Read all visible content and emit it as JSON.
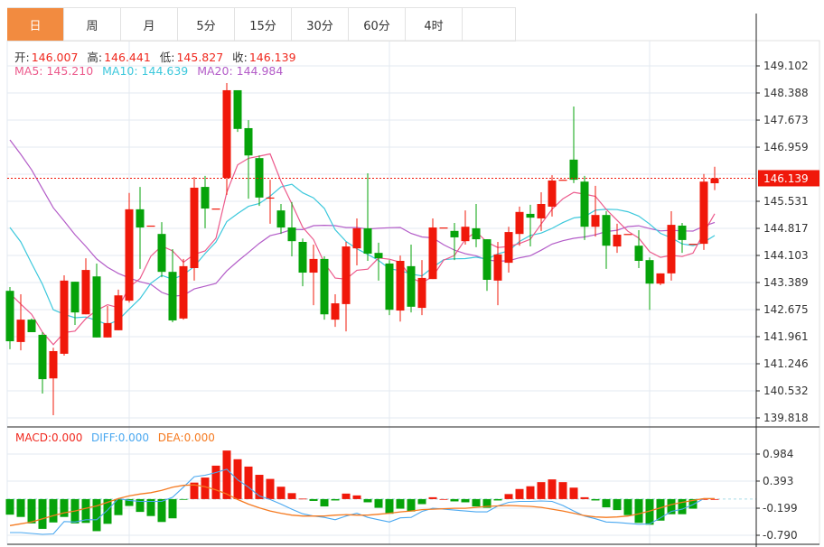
{
  "tabs": [
    {
      "label": "日",
      "active": true
    },
    {
      "label": "周"
    },
    {
      "label": "月"
    },
    {
      "label": "5分"
    },
    {
      "label": "15分"
    },
    {
      "label": "30分"
    },
    {
      "label": "60分"
    },
    {
      "label": "4时"
    }
  ],
  "ohlc_legend": {
    "open_label": "开:",
    "open": "146.007",
    "high_label": "高:",
    "high": "146.441",
    "low_label": "低:",
    "low": "145.827",
    "close_label": "收:",
    "close": "146.139"
  },
  "ma_legend": {
    "ma5": "MA5: 145.210",
    "ma10": "MA10: 144.639",
    "ma20": "MA20: 144.984"
  },
  "macd_legend": {
    "macd": "MACD:0.000",
    "diff": "DIFF:0.000",
    "dea": "DEA:0.000"
  },
  "colors": {
    "up": "#f0180a",
    "down": "#06a30a",
    "ma5": "#ec5a8c",
    "ma10": "#3cc8dc",
    "ma20": "#b35cc8",
    "diff": "#4aa8f0",
    "dea": "#f57a20",
    "tab_active": "#f28b40"
  },
  "chart_data": [
    {
      "type": "candlestick",
      "title": "Daily K-line",
      "ylim": [
        139.818,
        149.102
      ],
      "y_ticks": [
        "149.102",
        "148.388",
        "147.673",
        "146.959",
        "145.531",
        "144.817",
        "144.103",
        "143.389",
        "142.675",
        "141.961",
        "141.246",
        "140.532",
        "139.818"
      ],
      "current_price": "146.139",
      "ohlc": [
        [
          143.17,
          143.27,
          141.63,
          141.84
        ],
        [
          141.82,
          143.08,
          141.6,
          142.41
        ],
        [
          142.41,
          142.44,
          142.08,
          142.08
        ],
        [
          142.01,
          142.08,
          140.46,
          140.84
        ],
        [
          140.86,
          141.67,
          139.89,
          141.58
        ],
        [
          141.51,
          143.58,
          141.46,
          143.44
        ],
        [
          143.41,
          143.41,
          142.27,
          142.6
        ],
        [
          142.55,
          144.03,
          142.55,
          143.72
        ],
        [
          143.55,
          143.89,
          141.94,
          141.94
        ],
        [
          141.94,
          142.77,
          141.94,
          142.32
        ],
        [
          142.13,
          143.2,
          142.13,
          143.05
        ],
        [
          142.91,
          145.75,
          142.86,
          145.32
        ],
        [
          145.32,
          145.91,
          143.75,
          144.84
        ],
        [
          144.89,
          144.89,
          144.89,
          144.89
        ],
        [
          144.67,
          144.98,
          143.53,
          143.67
        ],
        [
          143.67,
          144.27,
          142.34,
          142.39
        ],
        [
          142.44,
          144.01,
          142.41,
          143.82
        ],
        [
          143.77,
          146.17,
          143.44,
          145.89
        ],
        [
          145.91,
          146.2,
          144.82,
          145.34
        ],
        [
          145.34,
          145.34,
          145.34,
          145.34
        ],
        [
          146.15,
          148.65,
          145.7,
          148.46
        ],
        [
          148.46,
          148.46,
          147.36,
          147.44
        ],
        [
          147.46,
          147.67,
          145.6,
          146.74
        ],
        [
          146.67,
          146.74,
          145.41,
          145.63
        ],
        [
          145.63,
          146.1,
          144.94,
          145.63
        ],
        [
          145.29,
          145.46,
          144.67,
          144.84
        ],
        [
          144.84,
          145.51,
          144.08,
          144.48
        ],
        [
          144.46,
          144.55,
          143.29,
          143.65
        ],
        [
          143.65,
          144.39,
          142.79,
          144.01
        ],
        [
          144.01,
          144.08,
          142.41,
          142.55
        ],
        [
          142.41,
          143.08,
          142.22,
          142.84
        ],
        [
          142.82,
          144.46,
          142.1,
          144.34
        ],
        [
          144.29,
          145.08,
          143.84,
          144.82
        ],
        [
          144.82,
          146.27,
          143.96,
          144.15
        ],
        [
          144.17,
          144.44,
          143.44,
          144.03
        ],
        [
          143.89,
          143.98,
          142.53,
          142.67
        ],
        [
          142.65,
          144.1,
          142.36,
          143.96
        ],
        [
          143.82,
          144.39,
          142.6,
          142.75
        ],
        [
          142.72,
          143.98,
          142.53,
          143.51
        ],
        [
          143.48,
          145.08,
          143.48,
          144.84
        ],
        [
          144.84,
          144.84,
          144.84,
          144.84
        ],
        [
          144.75,
          144.96,
          143.98,
          144.58
        ],
        [
          144.48,
          145.29,
          144.39,
          144.86
        ],
        [
          144.82,
          145.46,
          144.32,
          144.53
        ],
        [
          144.53,
          144.53,
          143.17,
          143.46
        ],
        [
          143.44,
          144.46,
          142.79,
          144.13
        ],
        [
          143.91,
          144.86,
          143.65,
          144.72
        ],
        [
          144.67,
          145.39,
          144.36,
          145.25
        ],
        [
          145.2,
          145.44,
          144.34,
          145.1
        ],
        [
          145.08,
          145.77,
          144.75,
          145.46
        ],
        [
          145.39,
          146.22,
          145.13,
          146.08
        ],
        [
          146.1,
          146.1,
          146.1,
          146.1
        ],
        [
          146.63,
          148.03,
          146.01,
          146.1
        ],
        [
          146.05,
          146.2,
          144.51,
          144.86
        ],
        [
          144.86,
          145.94,
          144.6,
          145.17
        ],
        [
          145.17,
          145.27,
          143.75,
          144.36
        ],
        [
          144.34,
          144.94,
          144.17,
          144.65
        ],
        [
          144.67,
          144.67,
          144.67,
          144.67
        ],
        [
          144.36,
          144.77,
          143.77,
          143.96
        ],
        [
          143.98,
          144.05,
          142.67,
          143.36
        ],
        [
          143.36,
          143.63,
          143.32,
          143.63
        ],
        [
          143.63,
          145.27,
          143.44,
          144.91
        ],
        [
          144.89,
          144.96,
          144.17,
          144.51
        ],
        [
          144.41,
          144.41,
          144.41,
          144.41
        ],
        [
          144.41,
          146.25,
          144.25,
          146.05
        ],
        [
          146.007,
          146.441,
          145.827,
          146.139
        ]
      ],
      "ma_lead": {
        "ma5": [
          143.1,
          142.82,
          142.55,
          142.08
        ],
        "ma10": [
          144.84,
          144.46,
          143.89,
          143.34,
          142.67,
          142.55,
          142.46,
          142.48,
          142.39
        ],
        "ma20": [
          147.15,
          146.77,
          146.36,
          145.86,
          145.36,
          145.01,
          144.65,
          144.34,
          144.01,
          143.79,
          143.63,
          143.51,
          143.41,
          143.34,
          143.13,
          143.03,
          143.05,
          143.22,
          143.29
        ]
      }
    },
    {
      "type": "bar+line",
      "title": "MACD",
      "ylim": [
        -0.79,
        0.984
      ],
      "y_ticks": [
        "0.984",
        "0.393",
        "-0.199",
        "-0.790"
      ],
      "macd": [
        -0.34,
        -0.39,
        -0.53,
        -0.65,
        -0.51,
        -0.39,
        -0.53,
        -0.52,
        -0.7,
        -0.54,
        -0.35,
        -0.15,
        -0.28,
        -0.37,
        -0.5,
        -0.42,
        -0.01,
        0.36,
        0.47,
        0.73,
        1.06,
        0.87,
        0.71,
        0.53,
        0.44,
        0.27,
        0.13,
        0.01,
        -0.04,
        -0.16,
        -0.03,
        0.12,
        0.08,
        -0.07,
        -0.19,
        -0.32,
        -0.21,
        -0.27,
        -0.11,
        0.04,
        0.0,
        -0.05,
        -0.07,
        -0.16,
        -0.19,
        -0.03,
        0.11,
        0.22,
        0.28,
        0.37,
        0.43,
        0.37,
        0.25,
        0.04,
        -0.03,
        -0.18,
        -0.24,
        -0.35,
        -0.52,
        -0.56,
        -0.47,
        -0.33,
        -0.33,
        -0.21,
        0.0,
        0.0
      ],
      "diff": [
        -0.73,
        -0.73,
        -0.75,
        -0.77,
        -0.76,
        -0.49,
        -0.5,
        -0.45,
        -0.45,
        -0.24,
        0.01,
        -0.03,
        -0.05,
        -0.05,
        -0.05,
        0.04,
        0.26,
        0.49,
        0.52,
        0.58,
        0.65,
        0.42,
        0.26,
        0.07,
        -0.01,
        -0.11,
        -0.22,
        -0.32,
        -0.37,
        -0.4,
        -0.45,
        -0.37,
        -0.31,
        -0.4,
        -0.45,
        -0.5,
        -0.41,
        -0.4,
        -0.27,
        -0.2,
        -0.22,
        -0.24,
        -0.26,
        -0.28,
        -0.28,
        -0.15,
        -0.07,
        -0.05,
        -0.05,
        -0.04,
        -0.05,
        -0.14,
        -0.26,
        -0.37,
        -0.43,
        -0.5,
        -0.51,
        -0.53,
        -0.55,
        -0.54,
        -0.41,
        -0.27,
        -0.22,
        -0.12,
        0.01,
        0.01
      ],
      "dea": [
        -0.58,
        -0.54,
        -0.5,
        -0.43,
        -0.36,
        -0.3,
        -0.26,
        -0.2,
        -0.15,
        -0.07,
        0.01,
        0.07,
        0.11,
        0.14,
        0.19,
        0.26,
        0.3,
        0.31,
        0.27,
        0.2,
        0.11,
        -0.01,
        -0.11,
        -0.19,
        -0.26,
        -0.31,
        -0.35,
        -0.37,
        -0.37,
        -0.37,
        -0.35,
        -0.34,
        -0.35,
        -0.35,
        -0.33,
        -0.31,
        -0.28,
        -0.26,
        -0.23,
        -0.22,
        -0.21,
        -0.2,
        -0.2,
        -0.18,
        -0.16,
        -0.15,
        -0.14,
        -0.15,
        -0.16,
        -0.18,
        -0.22,
        -0.26,
        -0.31,
        -0.36,
        -0.39,
        -0.4,
        -0.39,
        -0.37,
        -0.32,
        -0.26,
        -0.19,
        -0.12,
        -0.07,
        -0.03,
        0.01,
        0.01
      ]
    }
  ]
}
